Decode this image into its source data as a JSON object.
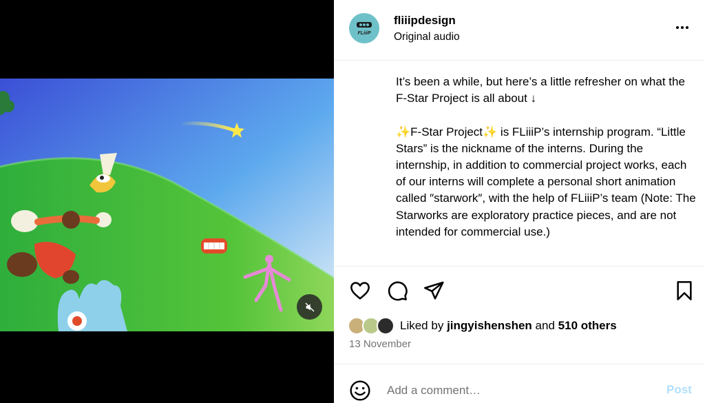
{
  "post": {
    "username": "fliiipdesign",
    "audio_label": "Original audio",
    "avatar_text": "FLiiiP",
    "caption": "It’s been a while, but here’s a little refresher on what the F-Star Project is all about ↓\n\n✨F-Star Project✨ is FLiiiP’s internship program. “Little Stars” is the nickname of the interns. During the internship, in addition to commercial project works, each of our interns will complete a personal short animation called ″starwork″, with the help of FLiiiP’s team (Note: The Starworks are exploratory practice pieces, and are not intended for commercial use.)",
    "likes": {
      "prefix": "Liked by",
      "user": "jingyishenshen",
      "joiner": "and",
      "others": "510 others"
    },
    "date": "13 November"
  },
  "comment": {
    "placeholder": "Add a comment…",
    "post_label": "Post"
  },
  "colors": {
    "accent_disabled": "#b2dffc",
    "secondary_text": "#737373",
    "divider": "#efefef"
  },
  "icons": [
    "more-options-icon",
    "heart-icon",
    "comment-icon",
    "share-icon",
    "bookmark-icon",
    "emoji-icon",
    "mute-icon"
  ]
}
